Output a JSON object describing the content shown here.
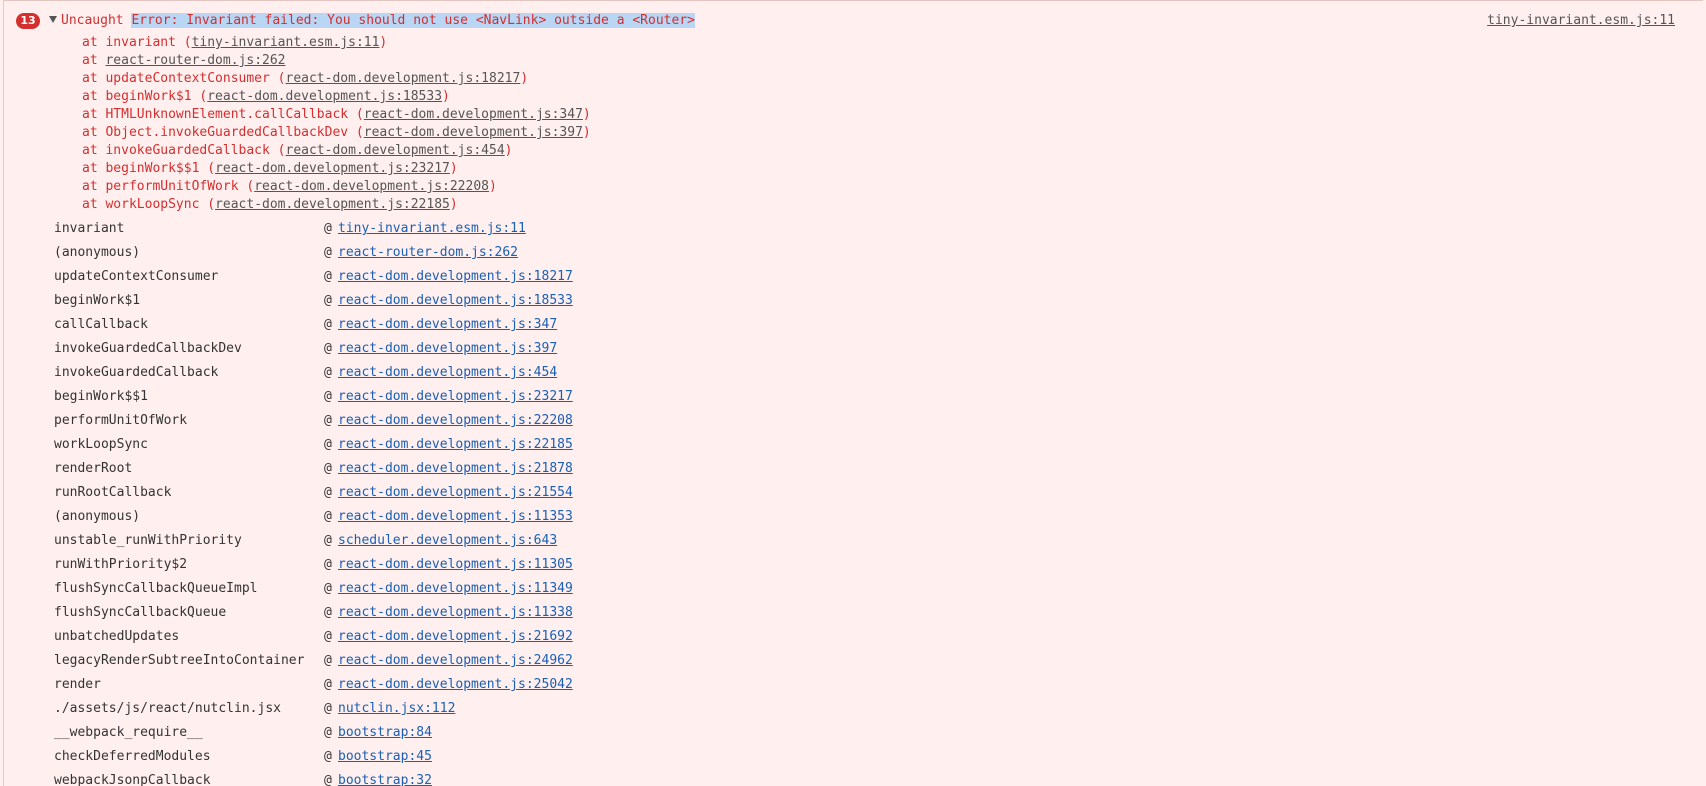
{
  "error": {
    "count": "13",
    "prefix": "Uncaught ",
    "message": "Error: Invariant failed: You should not use <NavLink> outside a <Router>",
    "source": "tiny-invariant.esm.js:11"
  },
  "stack_lines": [
    {
      "text": "at invariant (",
      "loc": "tiny-invariant.esm.js:11",
      "end": ")"
    },
    {
      "text": "at ",
      "loc": "react-router-dom.js:262",
      "end": ""
    },
    {
      "text": "at updateContextConsumer (",
      "loc": "react-dom.development.js:18217",
      "end": ")"
    },
    {
      "text": "at beginWork$1 (",
      "loc": "react-dom.development.js:18533",
      "end": ")"
    },
    {
      "text": "at HTMLUnknownElement.callCallback (",
      "loc": "react-dom.development.js:347",
      "end": ")"
    },
    {
      "text": "at Object.invokeGuardedCallbackDev (",
      "loc": "react-dom.development.js:397",
      "end": ")"
    },
    {
      "text": "at invokeGuardedCallback (",
      "loc": "react-dom.development.js:454",
      "end": ")"
    },
    {
      "text": "at beginWork$$1 (",
      "loc": "react-dom.development.js:23217",
      "end": ")"
    },
    {
      "text": "at performUnitOfWork (",
      "loc": "react-dom.development.js:22208",
      "end": ")"
    },
    {
      "text": "at workLoopSync (",
      "loc": "react-dom.development.js:22185",
      "end": ")"
    }
  ],
  "frames": [
    {
      "fn": "invariant",
      "at": "@",
      "link": "tiny-invariant.esm.js:11"
    },
    {
      "fn": "(anonymous)",
      "at": "@",
      "link": "react-router-dom.js:262"
    },
    {
      "fn": "updateContextConsumer",
      "at": "@",
      "link": "react-dom.development.js:18217"
    },
    {
      "fn": "beginWork$1",
      "at": "@",
      "link": "react-dom.development.js:18533"
    },
    {
      "fn": "callCallback",
      "at": "@",
      "link": "react-dom.development.js:347"
    },
    {
      "fn": "invokeGuardedCallbackDev",
      "at": "@",
      "link": "react-dom.development.js:397"
    },
    {
      "fn": "invokeGuardedCallback",
      "at": "@",
      "link": "react-dom.development.js:454"
    },
    {
      "fn": "beginWork$$1",
      "at": "@",
      "link": "react-dom.development.js:23217"
    },
    {
      "fn": "performUnitOfWork",
      "at": "@",
      "link": "react-dom.development.js:22208"
    },
    {
      "fn": "workLoopSync",
      "at": "@",
      "link": "react-dom.development.js:22185"
    },
    {
      "fn": "renderRoot",
      "at": "@",
      "link": "react-dom.development.js:21878"
    },
    {
      "fn": "runRootCallback",
      "at": "@",
      "link": "react-dom.development.js:21554"
    },
    {
      "fn": "(anonymous)",
      "at": "@",
      "link": "react-dom.development.js:11353"
    },
    {
      "fn": "unstable_runWithPriority",
      "at": "@",
      "link": "scheduler.development.js:643"
    },
    {
      "fn": "runWithPriority$2",
      "at": "@",
      "link": "react-dom.development.js:11305"
    },
    {
      "fn": "flushSyncCallbackQueueImpl",
      "at": "@",
      "link": "react-dom.development.js:11349"
    },
    {
      "fn": "flushSyncCallbackQueue",
      "at": "@",
      "link": "react-dom.development.js:11338"
    },
    {
      "fn": "unbatchedUpdates",
      "at": "@",
      "link": "react-dom.development.js:21692"
    },
    {
      "fn": "legacyRenderSubtreeIntoContainer",
      "at": "@",
      "link": "react-dom.development.js:24962"
    },
    {
      "fn": "render",
      "at": "@",
      "link": "react-dom.development.js:25042"
    },
    {
      "fn": "./assets/js/react/nutclin.jsx",
      "at": "@",
      "link": "nutclin.jsx:112"
    },
    {
      "fn": "__webpack_require__",
      "at": "@",
      "link": "bootstrap:84"
    },
    {
      "fn": "checkDeferredModules",
      "at": "@",
      "link": "bootstrap:45"
    },
    {
      "fn": "webpackJsonpCallback",
      "at": "@",
      "link": "bootstrap:32"
    }
  ]
}
